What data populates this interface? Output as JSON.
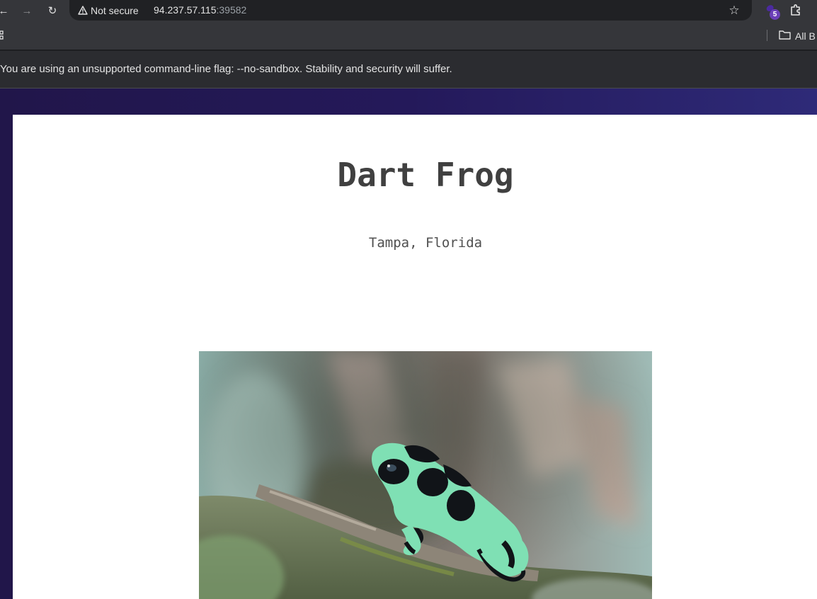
{
  "browser": {
    "security_label": "Not secure",
    "url_host": "94.237.57.115",
    "url_port": ":39582",
    "extension_badge": "5",
    "all_bookmarks_label": "All B",
    "infobar_message": "You are using an unsupported command-line flag: --no-sandbox. Stability and security will suffer."
  },
  "page": {
    "title": "Dart Frog",
    "location": "Tampa, Florida",
    "photo_subject": "green-and-black poison dart frog on mossy branch"
  },
  "colors": {
    "chrome_bg": "#35363a",
    "omnibox_bg": "#202124",
    "page_gradient_start": "#21164a",
    "page_gradient_end": "#2e2a78",
    "card_bg": "#ffffff",
    "title_color": "#404040",
    "frog_green": "#7fe0b4",
    "frog_black": "#111418"
  }
}
